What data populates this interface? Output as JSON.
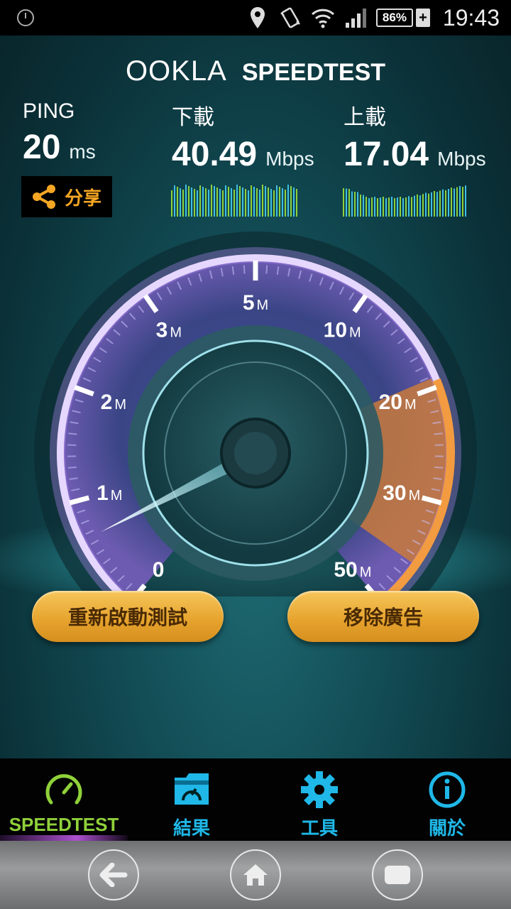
{
  "status_bar": {
    "battery": "86%",
    "charging": "+",
    "time": "19:43",
    "icons": [
      "power-icon",
      "location-icon",
      "vibrate-icon",
      "wifi-icon",
      "signal-icon"
    ]
  },
  "header": {
    "brand": "OOKLA",
    "product": "SPEEDTEST"
  },
  "results": {
    "ping": {
      "label": "PING",
      "value": "20",
      "unit": "ms"
    },
    "download": {
      "label": "下載",
      "value": "40.49",
      "unit": "Mbps"
    },
    "upload": {
      "label": "上載",
      "value": "17.04",
      "unit": "Mbps"
    },
    "share_label": "分享"
  },
  "gauge": {
    "ticks": [
      {
        "num": "0",
        "unit": ""
      },
      {
        "num": "1",
        "unit": "M"
      },
      {
        "num": "2",
        "unit": "M"
      },
      {
        "num": "3",
        "unit": "M"
      },
      {
        "num": "5",
        "unit": "M"
      },
      {
        "num": "10",
        "unit": "M"
      },
      {
        "num": "20",
        "unit": "M"
      },
      {
        "num": "30",
        "unit": "M"
      },
      {
        "num": "50",
        "unit": "M"
      }
    ]
  },
  "actions": {
    "restart": "重新啟動測試",
    "remove_ads": "移除廣告"
  },
  "tabs": [
    {
      "label": "SPEEDTEST",
      "icon": "speedometer-icon",
      "active": true
    },
    {
      "label": "結果",
      "icon": "results-folder-icon",
      "active": false
    },
    {
      "label": "工具",
      "icon": "gear-icon",
      "active": false
    },
    {
      "label": "關於",
      "icon": "info-icon",
      "active": false
    }
  ],
  "colors": {
    "accent_orange": "#f5a623",
    "tab_blue": "#1fb8e8",
    "tab_active_green": "#8fd13a",
    "button_gold": "#e5a22c"
  }
}
